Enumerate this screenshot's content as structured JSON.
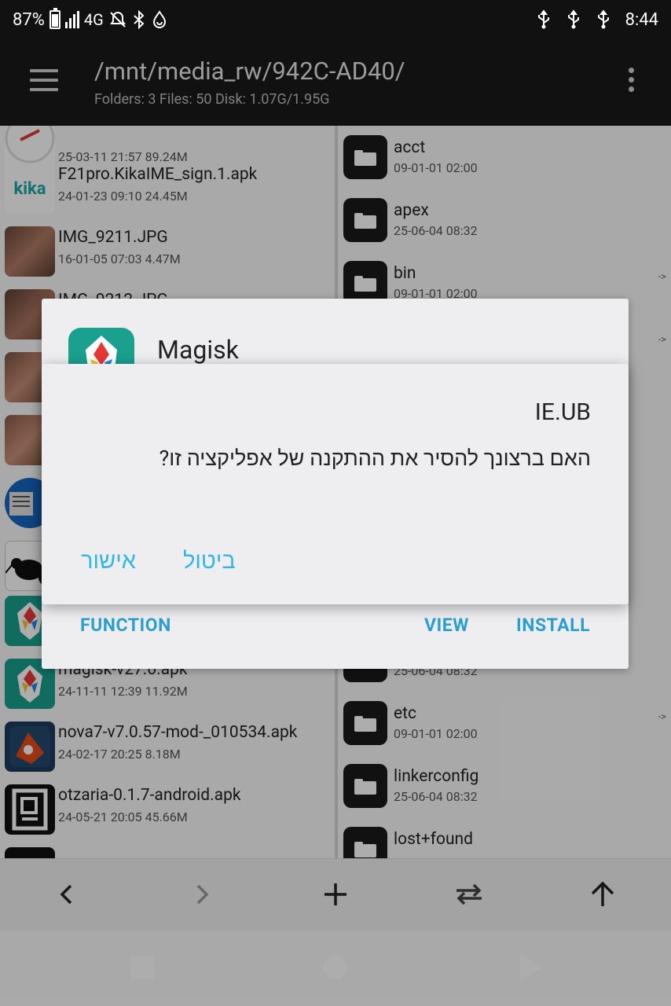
{
  "status_bar": {
    "battery": "87%",
    "network": "4G",
    "time": "8:44"
  },
  "app_bar": {
    "path": "/mnt/media_rw/942C-AD40/",
    "info": "Folders: 3  Files: 50  Disk: 1.07G/1.95G"
  },
  "left_pane": {
    "items": [
      {
        "name": "",
        "meta": "25-03-11 21:57   89.24M",
        "icon": "app-icon"
      },
      {
        "name": "F21pro.KikaIME_sign.1.apk",
        "meta": "24-01-23 09:10   24.45M",
        "icon": "kika-icon"
      },
      {
        "name": "IMG_9211.JPG",
        "meta": "16-01-05 07:03   4.47M",
        "icon": "photo-thumbnail"
      },
      {
        "name": "IMG_9212.JPG",
        "meta": "",
        "icon": "photo-thumbnail"
      },
      {
        "name": "",
        "meta": "",
        "icon": "photo-thumbnail"
      },
      {
        "name": "",
        "meta": "",
        "icon": "photo-thumbnail"
      },
      {
        "name": "",
        "meta": "",
        "icon": "book-icon"
      },
      {
        "name": "",
        "meta": "",
        "icon": "kiwi-icon"
      },
      {
        "name": "",
        "meta": "",
        "icon": "magisk-icon"
      },
      {
        "name": "magisk-v27.0.apk",
        "meta": "24-11-11 12:39   11.92M",
        "icon": "magisk-icon"
      },
      {
        "name": "nova7-v7.0.57-mod-_010534.apk",
        "meta": "24-02-17 20:25   8.18M",
        "icon": "nova-icon"
      },
      {
        "name": "otzaria-0.1.7-android.apk",
        "meta": "24-05-21 20:05   45.66M",
        "icon": "otzaria-icon"
      }
    ],
    "kika_label": "kika"
  },
  "right_pane": {
    "items": [
      {
        "name": "acct",
        "meta": "09-01-01 02:00",
        "arrow": ""
      },
      {
        "name": "apex",
        "meta": "25-06-04 08:32",
        "arrow": ""
      },
      {
        "name": "bin",
        "meta": "09-01-01 02:00",
        "arrow": "->"
      },
      {
        "name": "",
        "meta": "",
        "arrow": "->"
      },
      {
        "name": "",
        "meta": "25-06-04 08:32",
        "arrow": ""
      },
      {
        "name": "etc",
        "meta": "09-01-01 02:00",
        "arrow": "->"
      },
      {
        "name": "linkerconfig",
        "meta": "25-06-04 08:32",
        "arrow": ""
      },
      {
        "name": "lost+found",
        "meta": "",
        "arrow": ""
      }
    ]
  },
  "app_dialog": {
    "title": "Magisk",
    "function_label": "FUNCTION",
    "view_label": "VIEW",
    "install_label": "INSTALL"
  },
  "confirm_dialog": {
    "title": "IE.UB",
    "message": "האם ברצונך להסיר את ההתקנה של אפליקציה זו?",
    "ok_label": "אישור",
    "cancel_label": "ביטול"
  },
  "colors": {
    "accent": "#33b6e6",
    "dialog_button": "#2b9fd0",
    "app_bar": "#1a1a1a",
    "status_bar": "#111111"
  }
}
